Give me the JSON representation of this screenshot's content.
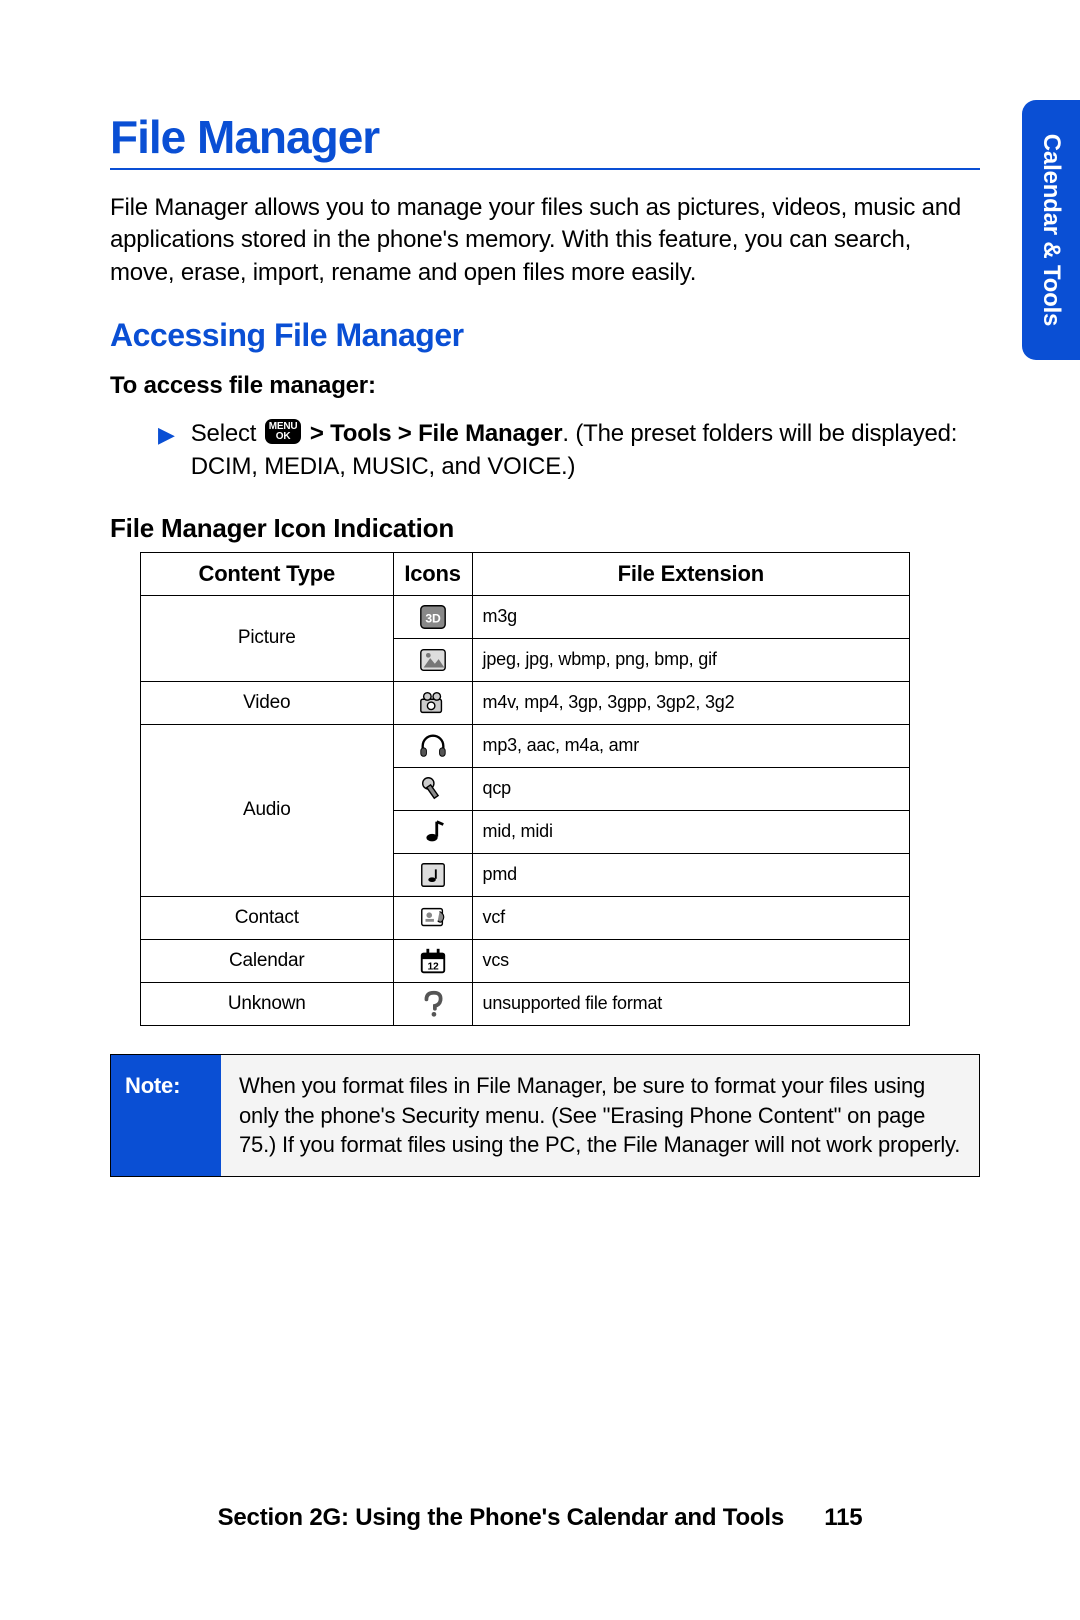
{
  "side_tab": "Calendar & Tools",
  "main_title": "File Manager",
  "intro": "File Manager allows you to manage your files such as pictures, videos, music and applications stored in the phone's memory. With this feature, you can search, move, erase, import, rename and open files more easily.",
  "section_title": "Accessing File Manager",
  "subhead": "To access file manager:",
  "step_prefix": "Select ",
  "menu_top": "MENU",
  "menu_bot": "OK",
  "step_bold": " > Tools > File Manager",
  "step_tail": ". (The preset folders will be displayed: DCIM, MEDIA, MUSIC, and VOICE.)",
  "minor_title": "File Manager Icon Indication",
  "table": {
    "headers": [
      "Content Type",
      "Icons",
      "File Extension"
    ],
    "groups": [
      {
        "type": "Picture",
        "rows": [
          {
            "icon": "3d",
            "ext": "m3g"
          },
          {
            "icon": "image",
            "ext": "jpeg, jpg, wbmp, png, bmp, gif"
          }
        ]
      },
      {
        "type": "Video",
        "rows": [
          {
            "icon": "camera",
            "ext": "m4v, mp4, 3gp, 3gpp, 3gp2, 3g2"
          }
        ]
      },
      {
        "type": "Audio",
        "rows": [
          {
            "icon": "headphones",
            "ext": "mp3, aac, m4a, amr"
          },
          {
            "icon": "mic",
            "ext": "qcp"
          },
          {
            "icon": "note",
            "ext": "mid, midi"
          },
          {
            "icon": "notebox",
            "ext": "pmd"
          }
        ]
      },
      {
        "type": "Contact",
        "rows": [
          {
            "icon": "card",
            "ext": "vcf"
          }
        ]
      },
      {
        "type": "Calendar",
        "rows": [
          {
            "icon": "cal",
            "ext": "vcs"
          }
        ]
      },
      {
        "type": "Unknown",
        "rows": [
          {
            "icon": "question",
            "ext": "unsupported file format"
          }
        ]
      }
    ]
  },
  "note": {
    "label": "Note:",
    "text": "When you format files in File Manager, be sure to format your files using only the phone's Security menu. (See \"Erasing Phone Content\" on page 75.) If you format files using the PC, the File Manager will not work properly."
  },
  "footer_section": "Section 2G: Using the Phone's Calendar and Tools",
  "page_number": "115"
}
